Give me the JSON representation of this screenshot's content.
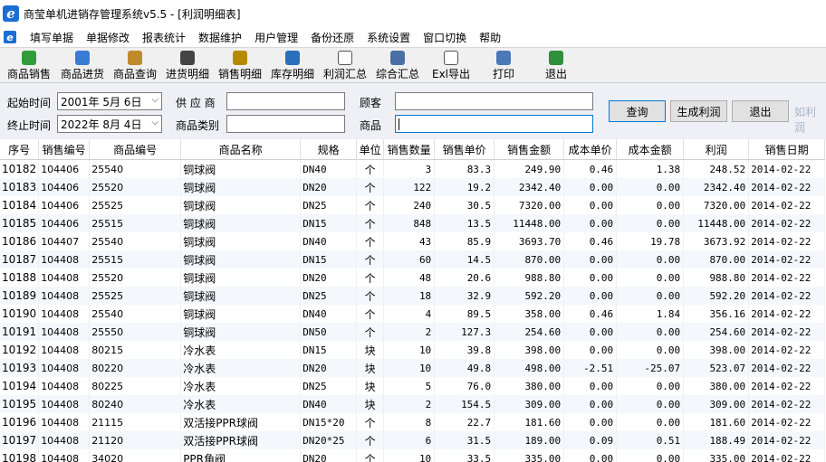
{
  "window": {
    "title": "商莹单机进销存管理系统v5.5 - [利润明细表]",
    "logo_letter": "e"
  },
  "menu": [
    "填写单据",
    "单据修改",
    "报表统计",
    "数据维护",
    "用户管理",
    "备份还原",
    "系统设置",
    "窗口切换",
    "帮助"
  ],
  "toolbar": [
    {
      "label": "商品销售",
      "icon": "money-bag-icon",
      "color": "#2e9d3a"
    },
    {
      "label": "商品进货",
      "icon": "document-icon",
      "color": "#3a7bd5"
    },
    {
      "label": "商品查询",
      "icon": "search-pen-icon",
      "color": "#c08a2b"
    },
    {
      "label": "进货明细",
      "icon": "film-list-icon",
      "color": "#444444"
    },
    {
      "label": "销售明细",
      "icon": "box-list-icon",
      "color": "#b58900"
    },
    {
      "label": "库存明细",
      "icon": "warehouse-icon",
      "color": "#2a6fba"
    },
    {
      "label": "利润汇总",
      "icon": "report-icon",
      "color": "#555555"
    },
    {
      "label": "综合汇总",
      "icon": "grid-icon",
      "color": "#4b6fa5"
    },
    {
      "label": "Exl导出",
      "icon": "export-icon",
      "color": "#555555"
    },
    {
      "label": "打印",
      "icon": "printer-icon",
      "color": "#4a78b8"
    },
    {
      "label": "退出",
      "icon": "exit-door-icon",
      "color": "#2f8f3a"
    }
  ],
  "filters": {
    "start_label": "起始时间",
    "start_date": "2001年 5月 6日",
    "end_label": "终止时间",
    "end_date": "2022年 8月 4日",
    "supplier_label": "供 应 商",
    "supplier_value": "",
    "category_label": "商品类别",
    "category_value": "",
    "customer_label": "顾客",
    "customer_value": "",
    "product_label": "商品",
    "product_value": ""
  },
  "buttons": {
    "query": "查询",
    "generate": "生成利润",
    "exit": "退出",
    "partial": "如利润"
  },
  "table": {
    "columns": [
      "序号",
      "销售编号",
      "商品编号",
      "商品名称",
      "规格",
      "单位",
      "销售数量",
      "销售单价",
      "销售金额",
      "成本单价",
      "成本金额",
      "利润",
      "销售日期"
    ],
    "rows": [
      [
        "10182",
        "104406",
        "25540",
        "铜球阀",
        "DN40",
        "个",
        "3",
        "83.3",
        "249.90",
        "0.46",
        "1.38",
        "248.52",
        "2014-02-22"
      ],
      [
        "10183",
        "104406",
        "25520",
        "铜球阀",
        "DN20",
        "个",
        "122",
        "19.2",
        "2342.40",
        "0.00",
        "0.00",
        "2342.40",
        "2014-02-22"
      ],
      [
        "10184",
        "104406",
        "25525",
        "铜球阀",
        "DN25",
        "个",
        "240",
        "30.5",
        "7320.00",
        "0.00",
        "0.00",
        "7320.00",
        "2014-02-22"
      ],
      [
        "10185",
        "104406",
        "25515",
        "铜球阀",
        "DN15",
        "个",
        "848",
        "13.5",
        "11448.00",
        "0.00",
        "0.00",
        "11448.00",
        "2014-02-22"
      ],
      [
        "10186",
        "104407",
        "25540",
        "铜球阀",
        "DN40",
        "个",
        "43",
        "85.9",
        "3693.70",
        "0.46",
        "19.78",
        "3673.92",
        "2014-02-22"
      ],
      [
        "10187",
        "104408",
        "25515",
        "铜球阀",
        "DN15",
        "个",
        "60",
        "14.5",
        "870.00",
        "0.00",
        "0.00",
        "870.00",
        "2014-02-22"
      ],
      [
        "10188",
        "104408",
        "25520",
        "铜球阀",
        "DN20",
        "个",
        "48",
        "20.6",
        "988.80",
        "0.00",
        "0.00",
        "988.80",
        "2014-02-22"
      ],
      [
        "10189",
        "104408",
        "25525",
        "铜球阀",
        "DN25",
        "个",
        "18",
        "32.9",
        "592.20",
        "0.00",
        "0.00",
        "592.20",
        "2014-02-22"
      ],
      [
        "10190",
        "104408",
        "25540",
        "铜球阀",
        "DN40",
        "个",
        "4",
        "89.5",
        "358.00",
        "0.46",
        "1.84",
        "356.16",
        "2014-02-22"
      ],
      [
        "10191",
        "104408",
        "25550",
        "铜球阀",
        "DN50",
        "个",
        "2",
        "127.3",
        "254.60",
        "0.00",
        "0.00",
        "254.60",
        "2014-02-22"
      ],
      [
        "10192",
        "104408",
        "80215",
        "冷水表",
        "DN15",
        "块",
        "10",
        "39.8",
        "398.00",
        "0.00",
        "0.00",
        "398.00",
        "2014-02-22"
      ],
      [
        "10193",
        "104408",
        "80220",
        "冷水表",
        "DN20",
        "块",
        "10",
        "49.8",
        "498.00",
        "-2.51",
        "-25.07",
        "523.07",
        "2014-02-22"
      ],
      [
        "10194",
        "104408",
        "80225",
        "冷水表",
        "DN25",
        "块",
        "5",
        "76.0",
        "380.00",
        "0.00",
        "0.00",
        "380.00",
        "2014-02-22"
      ],
      [
        "10195",
        "104408",
        "80240",
        "冷水表",
        "DN40",
        "块",
        "2",
        "154.5",
        "309.00",
        "0.00",
        "0.00",
        "309.00",
        "2014-02-22"
      ],
      [
        "10196",
        "104408",
        "21115",
        "双活接PPR球阀",
        "DN15*20",
        "个",
        "8",
        "22.7",
        "181.60",
        "0.00",
        "0.00",
        "181.60",
        "2014-02-22"
      ],
      [
        "10197",
        "104408",
        "21120",
        "双活接PPR球阀",
        "DN20*25",
        "个",
        "6",
        "31.5",
        "189.00",
        "0.09",
        "0.51",
        "188.49",
        "2014-02-22"
      ],
      [
        "10198",
        "104408",
        "34020",
        "PPR角阀",
        "DN20",
        "个",
        "10",
        "33.5",
        "335.00",
        "0.00",
        "0.00",
        "335.00",
        "2014-02-22"
      ]
    ]
  }
}
